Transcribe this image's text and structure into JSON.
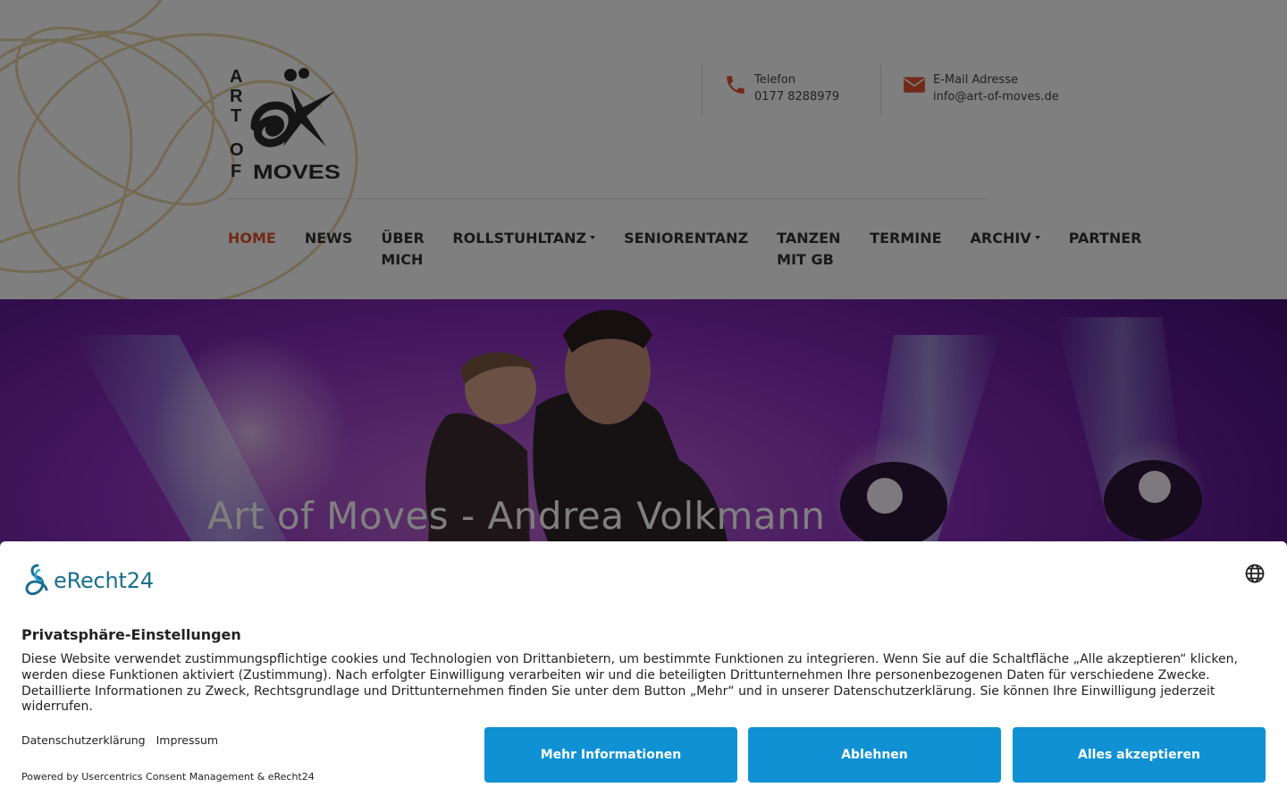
{
  "header": {
    "logo_text": "ART OF MOVES",
    "contacts": [
      {
        "icon": "phone-icon",
        "label": "Telefon",
        "value": "0177 8288979"
      },
      {
        "icon": "envelope-icon",
        "label": "E-Mail Adresse",
        "value": "info@art-of-moves.de"
      }
    ],
    "nav": [
      {
        "label": "HOME",
        "active": true
      },
      {
        "label": "NEWS"
      },
      {
        "label": "ÜBER MICH"
      },
      {
        "label": "ROLLSTUHLTANZ",
        "dropdown": true
      },
      {
        "label": "SENIORENTANZ"
      },
      {
        "label": "TANZEN MIT GB"
      },
      {
        "label": "TERMINE"
      },
      {
        "label": "ARCHIV",
        "dropdown": true
      },
      {
        "label": "PARTNER"
      }
    ],
    "colors": {
      "accent": "#e4532f",
      "logo_gold": "#e8d5a6"
    }
  },
  "hero": {
    "title": "Art of Moves - Andrea Volkmann"
  },
  "consent": {
    "brand": "eRecht24",
    "title": "Privatsphäre-Einstellungen",
    "text": "Diese Website verwendet zustimmungspflichtige cookies und Technologien von Drittanbietern, um bestimmte Funktionen zu integrieren. Wenn Sie auf die Schaltfläche „Alle akzeptieren“ klicken, werden diese Funktionen aktiviert (Zustimmung). Nach erfolgter Einwilligung verarbeiten wir und die beteiligten Drittunternehmen Ihre personenbezogenen Daten für verschiedene Zwecke. Detaillierte Informationen zu Zweck, Rechtsgrundlage und Drittunternehmen finden Sie unter dem Button „Mehr“ und in unserer Datenschutzerklärung. Sie können Ihre Einwilligung jederzeit widerrufen.",
    "links": [
      "Datenschutzerklärung",
      "Impressum"
    ],
    "powered_by": "Powered by Usercentrics Consent Management & eRecht24",
    "buttons": {
      "more": "Mehr Informationen",
      "deny": "Ablehnen",
      "accept": "Alles akzeptieren"
    },
    "colors": {
      "button": "#0f91d3",
      "brand": "#1a6e8e"
    }
  }
}
